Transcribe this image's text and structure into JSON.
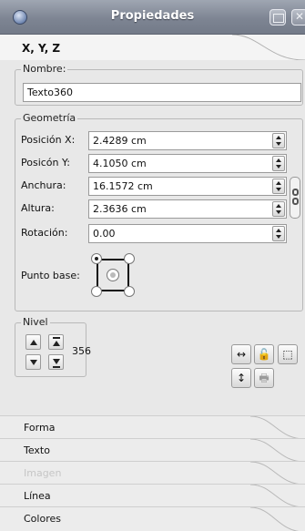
{
  "window": {
    "title": "Propiedades"
  },
  "section": {
    "title": "X, Y, Z"
  },
  "name_group": {
    "legend": "Nombre:",
    "value": "Texto360"
  },
  "geometry": {
    "legend": "Geometría",
    "fields": [
      {
        "label": "Posición X:",
        "value": "2.4289 cm"
      },
      {
        "label": "Posicón Y:",
        "value": "4.1050 cm"
      },
      {
        "label": "Anchura:",
        "value": "16.1572 cm"
      },
      {
        "label": "Altura:",
        "value": "2.3636 cm"
      },
      {
        "label": "Rotación:",
        "value": "0.00"
      }
    ],
    "base_point_label": "Punto base:"
  },
  "level": {
    "legend": "Nivel",
    "value": "356"
  },
  "bottom_tabs": [
    {
      "label": "Forma",
      "enabled": true
    },
    {
      "label": "Texto",
      "enabled": true
    },
    {
      "label": "Imagen",
      "enabled": false
    },
    {
      "label": "Línea",
      "enabled": true
    },
    {
      "label": "Colores",
      "enabled": true
    }
  ],
  "icons": {
    "app": "app-icon",
    "minimize": "minimize-icon",
    "close": "close-icon",
    "chain": "chain-link-icon",
    "flip_h": "flip-horizontal-icon",
    "lock": "lock-icon",
    "no_print": "no-print-icon",
    "flip_v": "flip-vertical-icon",
    "print": "print-icon"
  }
}
